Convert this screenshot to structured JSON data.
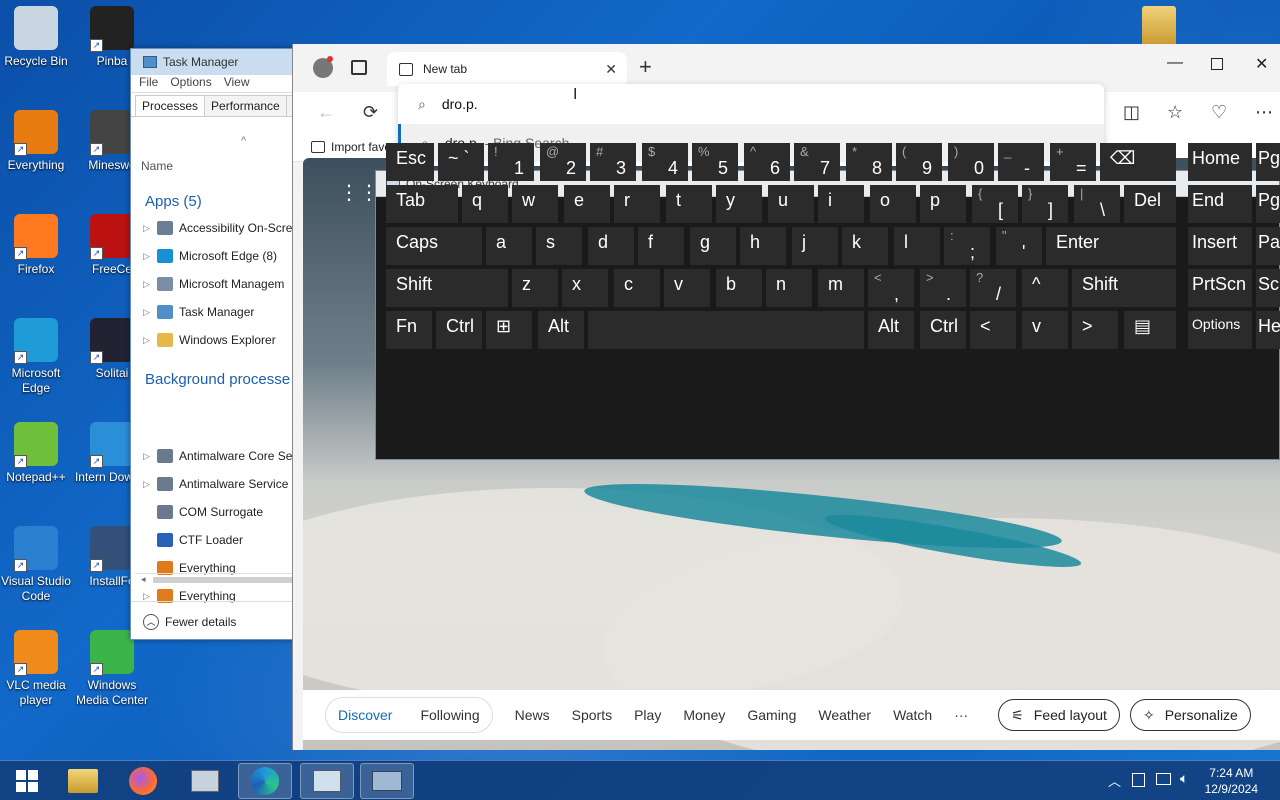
{
  "desktop": {
    "icons": [
      {
        "label": "Recycle Bin"
      },
      {
        "label": "Pinba"
      },
      {
        "label": "Everything"
      },
      {
        "label": "Mineswe"
      },
      {
        "label": "Firefox"
      },
      {
        "label": "FreeCe"
      },
      {
        "label": "Microsoft Edge"
      },
      {
        "label": "Solitai"
      },
      {
        "label": "Notepad++"
      },
      {
        "label": "Intern Downlo"
      },
      {
        "label": "Visual Studio Code"
      },
      {
        "label": "InstallFo"
      },
      {
        "label": "VLC media player"
      },
      {
        "label": "Windows Media Center"
      }
    ]
  },
  "task_manager": {
    "title": "Task Manager",
    "menu": [
      "File",
      "Options",
      "View"
    ],
    "tabs": [
      "Processes",
      "Performance",
      "A"
    ],
    "column_name": "Name",
    "sort_indicator": "^",
    "apps_header": "Apps (5)",
    "apps": [
      {
        "label": "Accessibility On-Scre",
        "color": "#6a7f96"
      },
      {
        "label": "Microsoft Edge (8)",
        "color": "#1b8fd4"
      },
      {
        "label": "Microsoft Managem",
        "color": "#7a8ea8"
      },
      {
        "label": "Task Manager",
        "color": "#4f8fc6"
      },
      {
        "label": "Windows Explorer",
        "color": "#e6b84a"
      }
    ],
    "bg_header": "Background processe",
    "background": [
      {
        "label": "Antimalware Core Se",
        "color": "#6b7a8c",
        "expandable": true
      },
      {
        "label": "Antimalware Service",
        "color": "#6b7a8c",
        "expandable": true
      },
      {
        "label": "COM Surrogate",
        "color": "#6b7a8c",
        "expandable": false
      },
      {
        "label": "CTF Loader",
        "color": "#2a62b8",
        "expandable": false
      },
      {
        "label": "Everything",
        "color": "#e07a1a",
        "expandable": false
      },
      {
        "label": "Everything",
        "color": "#e07a1a",
        "expandable": true
      }
    ],
    "fewer_details": "Fewer details"
  },
  "edge": {
    "tab_title": "New tab",
    "address_value": "dro.p.",
    "suggestion_query": "dro.p.",
    "suggestion_suffix": "- Bing Search",
    "favorites_import": "Import favor",
    "feed": {
      "discover": "Discover",
      "following": "Following",
      "items": [
        "News",
        "Sports",
        "Play",
        "Money",
        "Gaming",
        "Weather",
        "Watch",
        "···"
      ],
      "feed_layout": "Feed layout",
      "personalize": "Personalize"
    }
  },
  "osk": {
    "title": "On-Screen Keyboard",
    "rows": [
      [
        [
          "Esc",
          ""
        ],
        [
          "~ `",
          ""
        ],
        [
          "!",
          "1"
        ],
        [
          "@",
          "2"
        ],
        [
          "#",
          "3"
        ],
        [
          "$",
          "4"
        ],
        [
          "%",
          "5"
        ],
        [
          "^",
          "6"
        ],
        [
          "&",
          "7"
        ],
        [
          "*",
          "8"
        ],
        [
          "(",
          "9"
        ],
        [
          ")",
          "0"
        ],
        [
          "_",
          "-"
        ],
        [
          "+",
          "="
        ],
        [
          "⌫",
          ""
        ]
      ],
      [
        [
          "Tab",
          ""
        ],
        [
          "q",
          ""
        ],
        [
          "w",
          ""
        ],
        [
          "e",
          ""
        ],
        [
          "r",
          ""
        ],
        [
          "t",
          ""
        ],
        [
          "y",
          ""
        ],
        [
          "u",
          ""
        ],
        [
          "i",
          ""
        ],
        [
          "o",
          ""
        ],
        [
          "p",
          ""
        ],
        [
          "{",
          "["
        ],
        [
          "}",
          "]"
        ],
        [
          "|",
          "\\"
        ],
        [
          "Del",
          ""
        ]
      ],
      [
        [
          "Caps",
          ""
        ],
        [
          "a",
          ""
        ],
        [
          "s",
          ""
        ],
        [
          "d",
          ""
        ],
        [
          "f",
          ""
        ],
        [
          "g",
          ""
        ],
        [
          "h",
          ""
        ],
        [
          "j",
          ""
        ],
        [
          "k",
          ""
        ],
        [
          "l",
          ""
        ],
        [
          ":",
          ";"
        ],
        [
          "\"",
          "'"
        ],
        [
          "Enter",
          ""
        ]
      ],
      [
        [
          "Shift",
          ""
        ],
        [
          "z",
          ""
        ],
        [
          "x",
          ""
        ],
        [
          "c",
          ""
        ],
        [
          "v",
          ""
        ],
        [
          "b",
          ""
        ],
        [
          "n",
          ""
        ],
        [
          "m",
          ""
        ],
        [
          "<",
          ","
        ],
        [
          ">",
          "."
        ],
        [
          "?",
          "/"
        ],
        [
          "^",
          ""
        ],
        [
          "Shift",
          ""
        ]
      ],
      [
        [
          "Fn",
          ""
        ],
        [
          "Ctrl",
          ""
        ],
        [
          "⊞",
          ""
        ],
        [
          "Alt",
          ""
        ],
        [
          "",
          ""
        ],
        [
          "Alt",
          ""
        ],
        [
          "Ctrl",
          ""
        ],
        [
          "<",
          ""
        ],
        [
          "v",
          ""
        ],
        [
          ">",
          ""
        ],
        [
          "▤",
          ""
        ]
      ]
    ],
    "right_keys": [
      [
        "Home",
        "Pg"
      ],
      [
        "End",
        "Pg"
      ],
      [
        "Insert",
        "Pa"
      ],
      [
        "PrtScn",
        "Sc"
      ],
      [
        "Options",
        "He"
      ]
    ]
  },
  "taskbar": {
    "clock_time": "7:24 AM",
    "clock_date": "12/9/2024"
  }
}
